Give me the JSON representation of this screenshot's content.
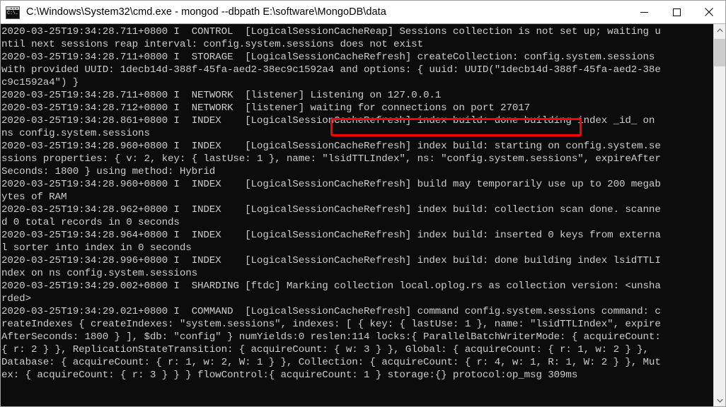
{
  "window": {
    "title": "C:\\Windows\\System32\\cmd.exe - mongod  --dbpath E:\\software\\MongoDB\\data",
    "icon_label": "C:\\.",
    "minimize_label": "Minimize",
    "maximize_label": "Maximize",
    "close_label": "Close"
  },
  "console": {
    "background_color": "#0c0c0c",
    "foreground_color": "#cccccc",
    "lines": [
      "2020-03-25T19:34:28.711+0800 I  CONTROL  [LogicalSessionCacheReap] Sessions collection is not set up; waiting u",
      "ntil next sessions reap interval: config.system.sessions does not exist",
      "2020-03-25T19:34:28.711+0800 I  STORAGE  [LogicalSessionCacheRefresh] createCollection: config.system.sessions",
      "with provided UUID: 1decb14d-388f-45fa-aed2-38ec9c1592a4 and options: { uuid: UUID(\"1decb14d-388f-45fa-aed2-38e",
      "c9c1592a4\") }",
      "2020-03-25T19:34:28.711+0800 I  NETWORK  [listener] Listening on 127.0.0.1",
      "2020-03-25T19:34:28.712+0800 I  NETWORK  [listener] waiting for connections on port 27017",
      "2020-03-25T19:34:28.861+0800 I  INDEX    [LogicalSessionCacheRefresh] index build: done building index _id_ on",
      "ns config.system.sessions",
      "2020-03-25T19:34:28.960+0800 I  INDEX    [LogicalSessionCacheRefresh] index build: starting on config.system.se",
      "ssions properties: { v: 2, key: { lastUse: 1 }, name: \"lsidTTLIndex\", ns: \"config.system.sessions\", expireAfter",
      "Seconds: 1800 } using method: Hybrid",
      "2020-03-25T19:34:28.960+0800 I  INDEX    [LogicalSessionCacheRefresh] build may temporarily use up to 200 megab",
      "ytes of RAM",
      "2020-03-25T19:34:28.962+0800 I  INDEX    [LogicalSessionCacheRefresh] index build: collection scan done. scanne",
      "d 0 total records in 0 seconds",
      "2020-03-25T19:34:28.964+0800 I  INDEX    [LogicalSessionCacheRefresh] index build: inserted 0 keys from externa",
      "l sorter into index in 0 seconds",
      "2020-03-25T19:34:28.996+0800 I  INDEX    [LogicalSessionCacheRefresh] index build: done building index lsidTTLI",
      "ndex on ns config.system.sessions",
      "2020-03-25T19:34:29.002+0800 I  SHARDING [ftdc] Marking collection local.oplog.rs as collection version: <unsha",
      "rded>",
      "2020-03-25T19:34:29.021+0800 I  COMMAND  [LogicalSessionCacheRefresh] command config.system.sessions command: c",
      "reateIndexes { createIndexes: \"system.sessions\", indexes: [ { key: { lastUse: 1 }, name: \"lsidTTLIndex\", expire",
      "AfterSeconds: 1800 } ], $db: \"config\" } numYields:0 reslen:114 locks:{ ParallelBatchWriterMode: { acquireCount:",
      "{ r: 2 } }, ReplicationStateTransition: { acquireCount: { w: 3 } }, Global: { acquireCount: { r: 1, w: 2 } },",
      "Database: { acquireCount: { r: 1, w: 2, W: 1 } }, Collection: { acquireCount: { r: 4, w: 1, R: 1, W: 2 } }, Mut",
      "ex: { acquireCount: { r: 3 } } } flowControl:{ acquireCount: 1 } storage:{} protocol:op_msg 309ms"
    ]
  },
  "annotation": {
    "highlight_text": "waiting for connections on port 27017",
    "color": "#ff0000"
  },
  "scrollbar": {
    "up_arrow": "scroll-up",
    "down_arrow": "scroll-down",
    "thumb": "scroll-thumb"
  }
}
